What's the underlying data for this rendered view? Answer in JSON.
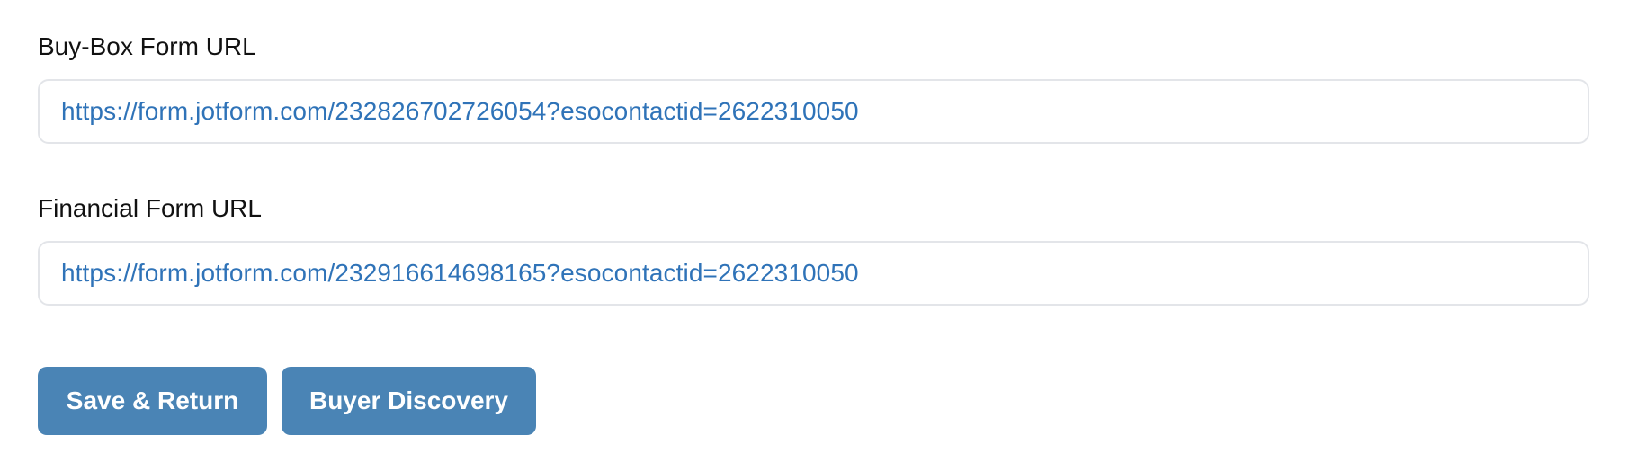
{
  "buy_box": {
    "label": "Buy-Box Form URL",
    "url": "https://form.jotform.com/232826702726054?esocontactid=2622310050"
  },
  "financial": {
    "label": "Financial Form URL",
    "url": "https://form.jotform.com/232916614698165?esocontactid=2622310050"
  },
  "actions": {
    "save_label": "Save & Return",
    "discovery_label": "Buyer Discovery"
  },
  "colors": {
    "button_bg": "#4a84b5",
    "link": "#2f73b8",
    "input_border": "#e3e5e9"
  }
}
